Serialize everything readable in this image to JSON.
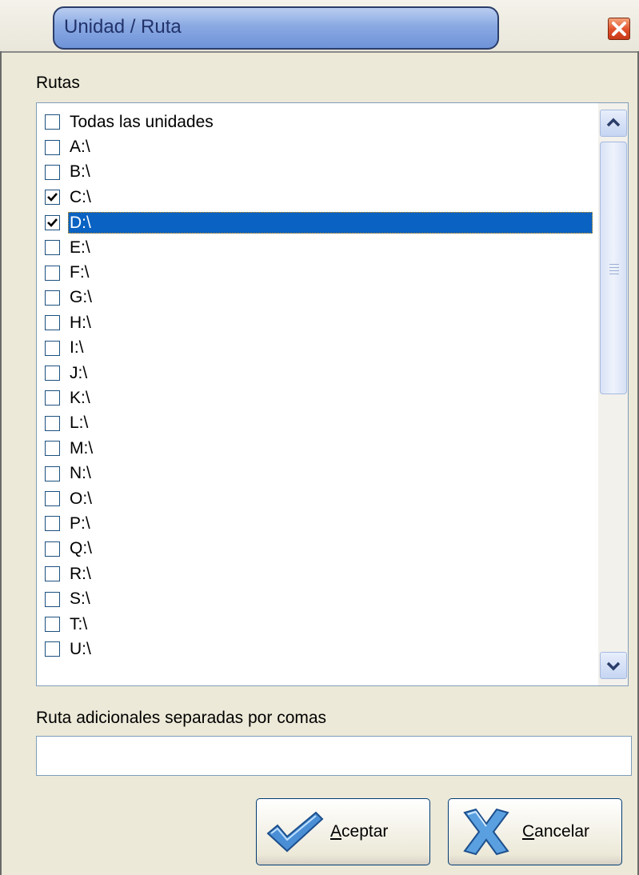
{
  "window": {
    "title": "Unidad / Ruta",
    "close_icon": "close-icon"
  },
  "rutas_label": "Rutas",
  "rutas_list": [
    {
      "label": "Todas las unidades",
      "checked": false,
      "selected": false
    },
    {
      "label": "A:\\",
      "checked": false,
      "selected": false
    },
    {
      "label": "B:\\",
      "checked": false,
      "selected": false
    },
    {
      "label": "C:\\",
      "checked": true,
      "selected": false
    },
    {
      "label": "D:\\",
      "checked": true,
      "selected": true
    },
    {
      "label": "E:\\",
      "checked": false,
      "selected": false
    },
    {
      "label": "F:\\",
      "checked": false,
      "selected": false
    },
    {
      "label": "G:\\",
      "checked": false,
      "selected": false
    },
    {
      "label": "H:\\",
      "checked": false,
      "selected": false
    },
    {
      "label": "I:\\",
      "checked": false,
      "selected": false
    },
    {
      "label": "J:\\",
      "checked": false,
      "selected": false
    },
    {
      "label": "K:\\",
      "checked": false,
      "selected": false
    },
    {
      "label": "L:\\",
      "checked": false,
      "selected": false
    },
    {
      "label": "M:\\",
      "checked": false,
      "selected": false
    },
    {
      "label": "N:\\",
      "checked": false,
      "selected": false
    },
    {
      "label": "O:\\",
      "checked": false,
      "selected": false
    },
    {
      "label": "P:\\",
      "checked": false,
      "selected": false
    },
    {
      "label": "Q:\\",
      "checked": false,
      "selected": false
    },
    {
      "label": "R:\\",
      "checked": false,
      "selected": false
    },
    {
      "label": "S:\\",
      "checked": false,
      "selected": false
    },
    {
      "label": "T:\\",
      "checked": false,
      "selected": false
    },
    {
      "label": "U:\\",
      "checked": false,
      "selected": false
    }
  ],
  "extra_paths": {
    "label": "Ruta adicionales separadas por comas",
    "value": "",
    "placeholder": ""
  },
  "buttons": {
    "accept": {
      "mnemonic": "A",
      "rest": "ceptar",
      "icon": "checkmark-icon"
    },
    "cancel": {
      "mnemonic": "C",
      "rest": "ancelar",
      "icon": "x-mark-icon"
    }
  },
  "colors": {
    "selection": "#0a62c2",
    "title_bar": "#8aa9e3",
    "close_button": "#e0502a",
    "dialog_background": "#ece9d8"
  }
}
